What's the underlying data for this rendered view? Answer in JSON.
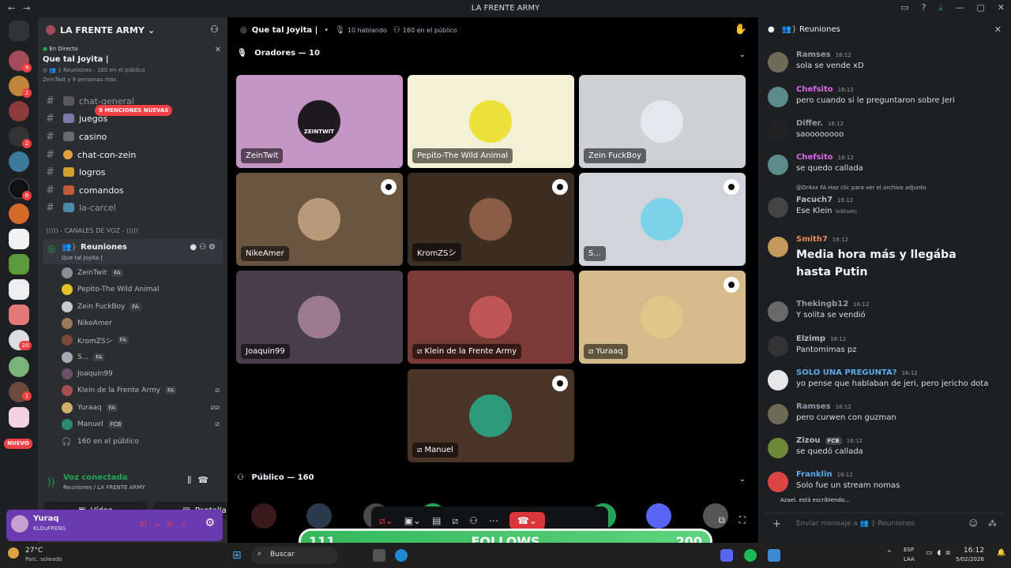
{
  "window": {
    "title": "LA FRENTE ARMY",
    "back": "←",
    "forward": "→"
  },
  "guilds": {
    "badges": [
      "9",
      "2",
      "2",
      "6",
      "20",
      "1"
    ],
    "new_label": "NUEVO"
  },
  "server": {
    "name": "LA FRENTE ARMY",
    "live": {
      "status": "En Directo",
      "title": "Que tal Joyita |",
      "channel": "Reuniones",
      "audience": "160 en el público",
      "people": "ZeinTwit y 9 personas más"
    },
    "mentions_pill": "9 MENCIONES NUEVAS",
    "channels": [
      {
        "name": "chat-general"
      },
      {
        "name": "juegos"
      },
      {
        "name": "casino"
      },
      {
        "name": "chat-con-zein"
      },
      {
        "name": "logros"
      },
      {
        "name": "comandos"
      },
      {
        "name": "la-carcel"
      }
    ],
    "voice_category": "))))) - CANALES DE VOZ - (((((",
    "voice_channel": {
      "name": "Reuniones",
      "subtitle": "Que tal Joyita |"
    },
    "members": [
      {
        "name": "ZeinTwit",
        "tag": "FA",
        "color": "#8b8f9a"
      },
      {
        "name": "Pepito-The Wild Animal",
        "tag": "",
        "color": "#e2c32a"
      },
      {
        "name": "Zein FuckBoy",
        "tag": "FA",
        "color": "#c9c9cf"
      },
      {
        "name": "NikeAmer",
        "tag": "",
        "color": "#9a7b5a"
      },
      {
        "name": "KromZSシ",
        "tag": "FA",
        "color": "#7a4a38"
      },
      {
        "name": "S...",
        "tag": "FA",
        "color": "#a8aab5"
      },
      {
        "name": "Joaquin99",
        "tag": "",
        "color": "#6a5166"
      },
      {
        "name": "Klein de la Frente Army",
        "tag": "FA",
        "color": "#a65050"
      },
      {
        "name": "Yuraaq",
        "tag": "FA",
        "color": "#d1b06a"
      },
      {
        "name": "Manuel",
        "tag": "FCB",
        "color": "#2c8a73"
      }
    ],
    "audience_row": "160 en el público"
  },
  "voice_panel": {
    "status": "Voz conectada",
    "location": "Reuniones / LA FRENTE ARMY",
    "video_label": "Vídeo",
    "screen_label": "Pantalla"
  },
  "user_panel": {
    "name": "Yuraq",
    "status": "KLOuFRENS"
  },
  "stage": {
    "title": "Que tal Joyita |",
    "speaking": "10 hablando",
    "audience": "160 en el público",
    "speakers_header": "Oradores — 10",
    "public_header": "Público — 160",
    "tiles": [
      {
        "name": "ZeinTwit",
        "bg": "#c595c6",
        "avatar": "#1e1a1f",
        "pin": false,
        "muted": false,
        "avatar_text": "ZEINTWIT"
      },
      {
        "name": "Pepito-The Wild Animal",
        "bg": "#f2f1d6",
        "avatar": "#efe13c",
        "pin": false,
        "muted": false,
        "avatar_text": ""
      },
      {
        "name": "Zein FuckBoy",
        "bg": "#cfd0d4",
        "avatar": "#e6e8ee",
        "pin": false,
        "muted": false,
        "avatar_text": ""
      },
      {
        "name": "NikeAmer",
        "bg": "#6a5541",
        "avatar": "#b89a7b",
        "pin": true,
        "muted": false,
        "avatar_text": ""
      },
      {
        "name": "KromZSシ",
        "bg": "#3c2e22",
        "avatar": "#8a5b45",
        "pin": true,
        "muted": false,
        "avatar_text": ""
      },
      {
        "name": "S...",
        "bg": "#d2d4dc",
        "avatar": "#7ad3e8",
        "pin": true,
        "muted": false,
        "avatar_text": ""
      },
      {
        "name": "Joaquin99",
        "bg": "#4a3e4c",
        "avatar": "#9a7a8c",
        "pin": false,
        "muted": false,
        "avatar_text": ""
      },
      {
        "name": "Klein de la Frente Army",
        "bg": "#7a3a36",
        "avatar": "#c05555",
        "pin": false,
        "muted": true,
        "avatar_text": ""
      },
      {
        "name": "Yuraaq",
        "bg": "#d5ba8c",
        "avatar": "#e0c689",
        "pin": true,
        "muted": true,
        "avatar_text": ""
      },
      {
        "name": "Manuel",
        "bg": "#4a3428",
        "avatar": "#2d9a7a",
        "pin": true,
        "muted": true,
        "avatar_text": ""
      }
    ]
  },
  "chat": {
    "header": "Reuniones",
    "input_placeholder": "Enviar mensaje a 👥 } Reuniones",
    "typing": "Azael. está escribiendo…",
    "messages": [
      {
        "name": "Ramses",
        "time": "16:12",
        "text": "sola se vende xD",
        "color": "#949ba4",
        "av": "#6e6a58"
      },
      {
        "name": "Chefsito",
        "time": "16:12",
        "text": "pero cuando si le preguntaron sobre Jeri",
        "color": "#d86ae6",
        "av": "#5a8a8a"
      },
      {
        "name": "Differ.",
        "time": "16:12",
        "text": "saoooooooo",
        "color": "#949ba4",
        "av": "#222"
      },
      {
        "name": "Chefsito",
        "time": "16:12",
        "text": "se quedo callada",
        "color": "#d86ae6",
        "av": "#5a8a8a"
      },
      {
        "name": "Facuch7",
        "time": "16:12",
        "text": "Ese Klein",
        "reply": "@Dr4xx  FA  Haz clic para ver el archivo adjunto",
        "edited": "(editado)",
        "color": "#b5bac1",
        "av": "#444"
      },
      {
        "name": "Smith7",
        "time": "16:12",
        "text": "Media hora más y llegába hasta Putin",
        "color": "#e58a5a",
        "av": "#c49a5a",
        "big": true
      },
      {
        "name": "Thekingb12",
        "time": "16:12",
        "text": "Y solita se vendió",
        "color": "#949ba4",
        "av": "#6a6a6a"
      },
      {
        "name": "Elzimp",
        "time": "16:12",
        "text": "Pantomimas pz",
        "color": "#b5bac1",
        "av": "#333"
      },
      {
        "name": "SOLO UNA PREGUNTA?",
        "time": "16:12",
        "text": "yo pense que hablaban de jeri,  pero jericho dota",
        "color": "#5aa9e6",
        "av": "#e8e8e8"
      },
      {
        "name": "Ramses",
        "time": "16:12",
        "text": "pero curwen con guzman",
        "color": "#949ba4",
        "av": "#6e6a58"
      },
      {
        "name": "Zizou",
        "time": "16:12",
        "text": "se quedó callada",
        "tag": "FCB",
        "color": "#b5bac1",
        "av": "#6a8a3a"
      },
      {
        "name": "Franklin",
        "time": "16:12",
        "text": "Solo fue un stream nomas",
        "color": "#5aa9e6",
        "av": "#d44"
      }
    ]
  },
  "overlay": {
    "left": "111",
    "center": "FOLLOWS",
    "right": "200"
  },
  "taskbar": {
    "weather_temp": "27°C",
    "weather_desc": "Parc. soleado",
    "search": "Buscar",
    "lang": "ESP",
    "lang2": "LAA",
    "time": "16:12",
    "date": "5/02/2026"
  }
}
